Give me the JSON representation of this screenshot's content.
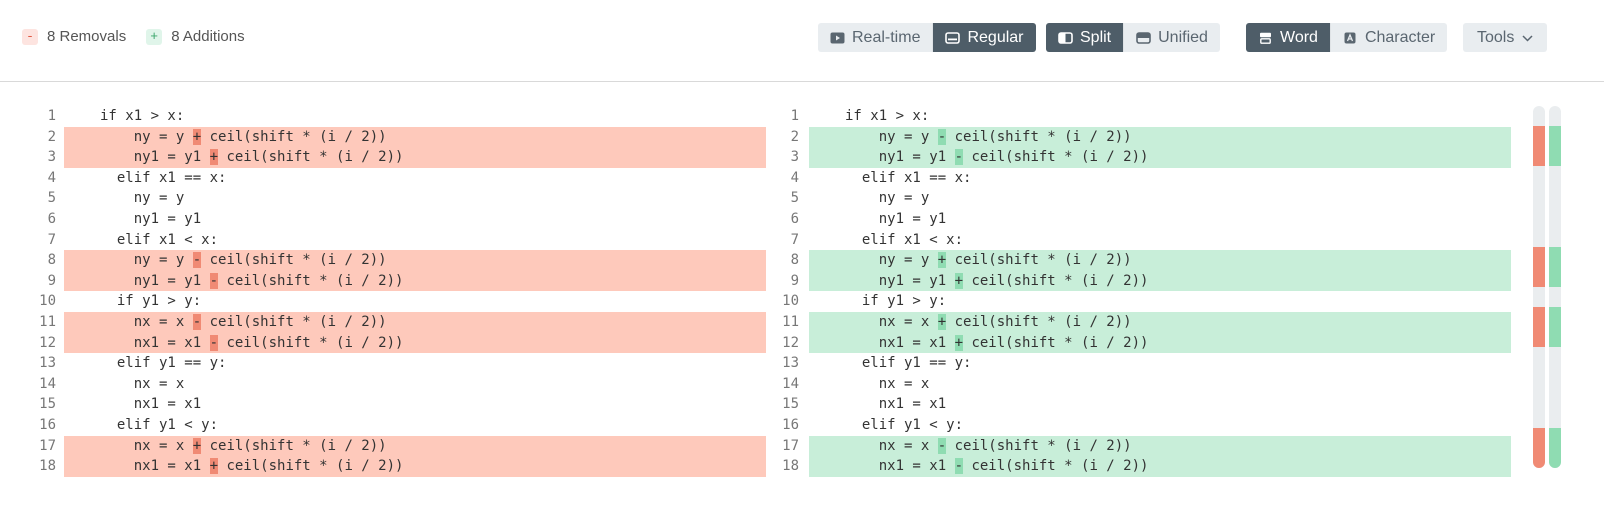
{
  "summary": {
    "removals_symbol": "-",
    "removals_label": "8 Removals",
    "additions_symbol": "+",
    "additions_label": "8 Additions"
  },
  "toolbar": {
    "realtime_label": "Real-time",
    "regular_label": "Regular",
    "split_label": "Split",
    "unified_label": "Unified",
    "word_label": "Word",
    "character_label": "Character",
    "tools_label": "Tools"
  },
  "colors": {
    "removed_line": "#fec9bb",
    "removed_token": "#f08a74",
    "added_line": "#c8eed9",
    "added_token": "#8fdcb2",
    "active_button": "#4e5d68"
  },
  "left_lines": [
    {
      "num": "1",
      "changed": false,
      "segs": [
        {
          "t": "if x1 > x:"
        }
      ]
    },
    {
      "num": "2",
      "changed": true,
      "segs": [
        {
          "t": "    ny = y "
        },
        {
          "t": "+",
          "hl": true
        },
        {
          "t": " ceil(shift * (i / 2))"
        }
      ]
    },
    {
      "num": "3",
      "changed": true,
      "segs": [
        {
          "t": "    ny1 = y1 "
        },
        {
          "t": "+",
          "hl": true
        },
        {
          "t": " ceil(shift * (i / 2))"
        }
      ]
    },
    {
      "num": "4",
      "changed": false,
      "segs": [
        {
          "t": "  elif x1 == x:"
        }
      ]
    },
    {
      "num": "5",
      "changed": false,
      "segs": [
        {
          "t": "    ny = y"
        }
      ]
    },
    {
      "num": "6",
      "changed": false,
      "segs": [
        {
          "t": "    ny1 = y1"
        }
      ]
    },
    {
      "num": "7",
      "changed": false,
      "segs": [
        {
          "t": "  elif x1 < x:"
        }
      ]
    },
    {
      "num": "8",
      "changed": true,
      "segs": [
        {
          "t": "    ny = y "
        },
        {
          "t": "-",
          "hl": true
        },
        {
          "t": " ceil(shift * (i / 2))"
        }
      ]
    },
    {
      "num": "9",
      "changed": true,
      "segs": [
        {
          "t": "    ny1 = y1 "
        },
        {
          "t": "-",
          "hl": true
        },
        {
          "t": " ceil(shift * (i / 2))"
        }
      ]
    },
    {
      "num": "10",
      "changed": false,
      "segs": [
        {
          "t": "  if y1 > y:"
        }
      ]
    },
    {
      "num": "11",
      "changed": true,
      "segs": [
        {
          "t": "    nx = x "
        },
        {
          "t": "-",
          "hl": true
        },
        {
          "t": " ceil(shift * (i / 2))"
        }
      ]
    },
    {
      "num": "12",
      "changed": true,
      "segs": [
        {
          "t": "    nx1 = x1 "
        },
        {
          "t": "-",
          "hl": true
        },
        {
          "t": " ceil(shift * (i / 2))"
        }
      ]
    },
    {
      "num": "13",
      "changed": false,
      "segs": [
        {
          "t": "  elif y1 == y:"
        }
      ]
    },
    {
      "num": "14",
      "changed": false,
      "segs": [
        {
          "t": "    nx = x"
        }
      ]
    },
    {
      "num": "15",
      "changed": false,
      "segs": [
        {
          "t": "    nx1 = x1"
        }
      ]
    },
    {
      "num": "16",
      "changed": false,
      "segs": [
        {
          "t": "  elif y1 < y:"
        }
      ]
    },
    {
      "num": "17",
      "changed": true,
      "segs": [
        {
          "t": "    nx = x "
        },
        {
          "t": "+",
          "hl": true
        },
        {
          "t": " ceil(shift * (i / 2))"
        }
      ]
    },
    {
      "num": "18",
      "changed": true,
      "segs": [
        {
          "t": "    nx1 = x1 "
        },
        {
          "t": "+",
          "hl": true
        },
        {
          "t": " ceil(shift * (i / 2))"
        }
      ]
    }
  ],
  "right_lines": [
    {
      "num": "1",
      "changed": false,
      "segs": [
        {
          "t": "if x1 > x:"
        }
      ]
    },
    {
      "num": "2",
      "changed": true,
      "segs": [
        {
          "t": "    ny = y "
        },
        {
          "t": "-",
          "hl": true
        },
        {
          "t": " ceil(shift * (i / 2))"
        }
      ]
    },
    {
      "num": "3",
      "changed": true,
      "segs": [
        {
          "t": "    ny1 = y1 "
        },
        {
          "t": "-",
          "hl": true
        },
        {
          "t": " ceil(shift * (i / 2))"
        }
      ]
    },
    {
      "num": "4",
      "changed": false,
      "segs": [
        {
          "t": "  elif x1 == x:"
        }
      ]
    },
    {
      "num": "5",
      "changed": false,
      "segs": [
        {
          "t": "    ny = y"
        }
      ]
    },
    {
      "num": "6",
      "changed": false,
      "segs": [
        {
          "t": "    ny1 = y1"
        }
      ]
    },
    {
      "num": "7",
      "changed": false,
      "segs": [
        {
          "t": "  elif x1 < x:"
        }
      ]
    },
    {
      "num": "8",
      "changed": true,
      "segs": [
        {
          "t": "    ny = y "
        },
        {
          "t": "+",
          "hl": true
        },
        {
          "t": " ceil(shift * (i / 2))"
        }
      ]
    },
    {
      "num": "9",
      "changed": true,
      "segs": [
        {
          "t": "    ny1 = y1 "
        },
        {
          "t": "+",
          "hl": true
        },
        {
          "t": " ceil(shift * (i / 2))"
        }
      ]
    },
    {
      "num": "10",
      "changed": false,
      "segs": [
        {
          "t": "  if y1 > y:"
        }
      ]
    },
    {
      "num": "11",
      "changed": true,
      "segs": [
        {
          "t": "    nx = x "
        },
        {
          "t": "+",
          "hl": true
        },
        {
          "t": " ceil(shift * (i / 2))"
        }
      ]
    },
    {
      "num": "12",
      "changed": true,
      "segs": [
        {
          "t": "    nx1 = x1 "
        },
        {
          "t": "+",
          "hl": true
        },
        {
          "t": " ceil(shift * (i / 2))"
        }
      ]
    },
    {
      "num": "13",
      "changed": false,
      "segs": [
        {
          "t": "  elif y1 == y:"
        }
      ]
    },
    {
      "num": "14",
      "changed": false,
      "segs": [
        {
          "t": "    nx = x"
        }
      ]
    },
    {
      "num": "15",
      "changed": false,
      "segs": [
        {
          "t": "    nx1 = x1"
        }
      ]
    },
    {
      "num": "16",
      "changed": false,
      "segs": [
        {
          "t": "  elif y1 < y:"
        }
      ]
    },
    {
      "num": "17",
      "changed": true,
      "segs": [
        {
          "t": "    nx = x "
        },
        {
          "t": "-",
          "hl": true
        },
        {
          "t": " ceil(shift * (i / 2))"
        }
      ]
    },
    {
      "num": "18",
      "changed": true,
      "segs": [
        {
          "t": "    nx1 = x1 "
        },
        {
          "t": "-",
          "hl": true
        },
        {
          "t": " ceil(shift * (i / 2))"
        }
      ]
    }
  ]
}
